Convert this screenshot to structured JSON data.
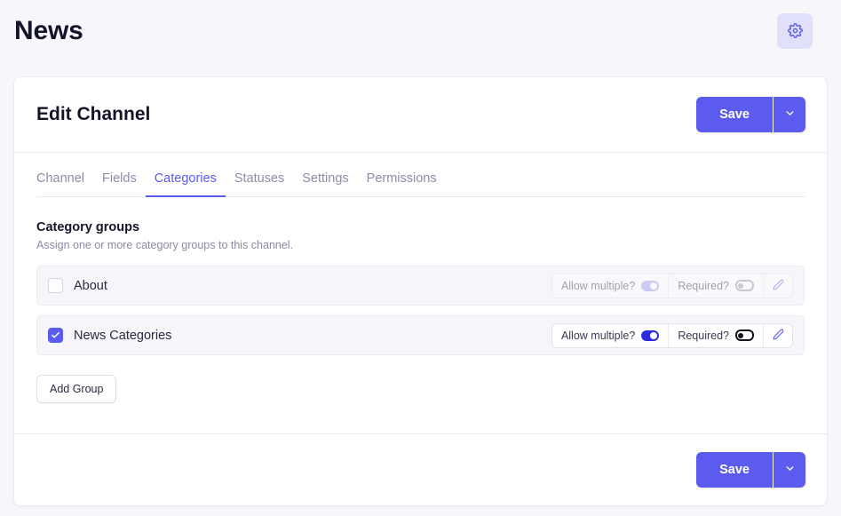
{
  "header": {
    "title": "News",
    "settings_icon": "gear-icon"
  },
  "card": {
    "title": "Edit Channel",
    "save_label": "Save",
    "save_caret_icon": "chevron-down-icon"
  },
  "tabs": [
    {
      "label": "Channel",
      "active": false
    },
    {
      "label": "Fields",
      "active": false
    },
    {
      "label": "Categories",
      "active": true
    },
    {
      "label": "Statuses",
      "active": false
    },
    {
      "label": "Settings",
      "active": false
    },
    {
      "label": "Permissions",
      "active": false
    }
  ],
  "section": {
    "title": "Category groups",
    "subtitle": "Assign one or more category groups to this channel.",
    "add_group_label": "Add Group"
  },
  "groups": [
    {
      "name": "About",
      "checked": false,
      "dimmed": true,
      "allow_multiple_label": "Allow multiple?",
      "allow_multiple_state": "on",
      "required_label": "Required?",
      "required_state": "off",
      "edit_icon": "pencil-icon"
    },
    {
      "name": "News Categories",
      "checked": true,
      "dimmed": false,
      "allow_multiple_label": "Allow multiple?",
      "allow_multiple_state": "on",
      "required_label": "Required?",
      "required_state": "off",
      "edit_icon": "pencil-icon"
    }
  ],
  "footer": {
    "save_label": "Save",
    "save_caret_icon": "chevron-down-icon"
  },
  "colors": {
    "accent": "#5b5bef",
    "toggle_on": "#2b2bdd",
    "page_bg": "#f6f6fb",
    "row_bg": "#f5f5fa"
  }
}
